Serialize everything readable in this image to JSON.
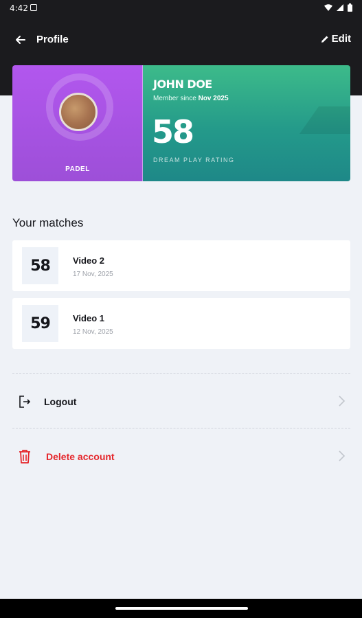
{
  "status_bar": {
    "time": "4:42"
  },
  "app_bar": {
    "title": "Profile",
    "edit_label": "Edit"
  },
  "profile_card": {
    "sport": "PADEL",
    "name": "JOHN DOE",
    "member_since_prefix": "Member since",
    "member_since_date": "Nov 2025",
    "rating": "58",
    "rating_label": "DREAM PLAY RATING",
    "colors": {
      "left": "#b257ee",
      "right_top": "#3dbb8a",
      "right_bottom": "#1e8888"
    }
  },
  "matches_section": {
    "title": "Your matches",
    "items": [
      {
        "score": "58",
        "title": "Video 2",
        "date": "17 Nov, 2025"
      },
      {
        "score": "59",
        "title": "Video 1",
        "date": "12 Nov, 2025"
      }
    ]
  },
  "menu": {
    "logout": {
      "label": "Logout",
      "icon": "logout-icon"
    },
    "delete": {
      "label": "Delete account",
      "icon": "trash-icon",
      "color": "#e5262b"
    }
  }
}
